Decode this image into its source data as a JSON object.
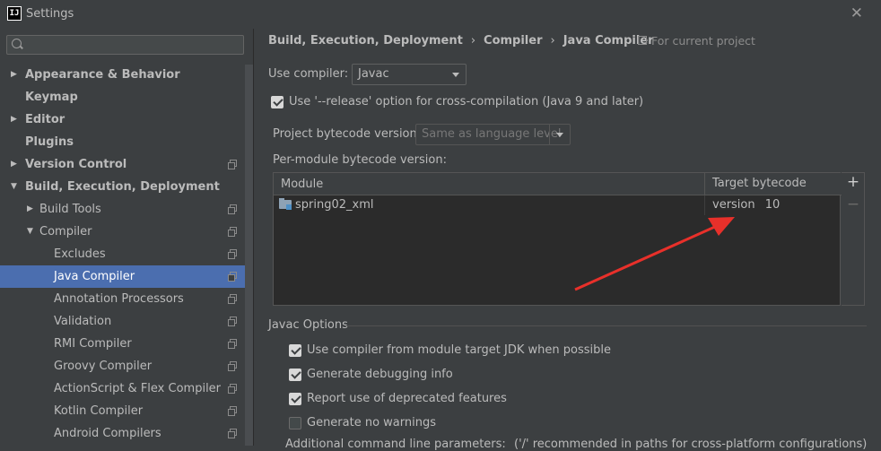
{
  "window": {
    "title": "Settings",
    "app_icon": "IJ",
    "close_glyph": "✕"
  },
  "sidebar": {
    "search_placeholder": "",
    "items": [
      {
        "label": "Appearance & Behavior",
        "arrow": "▶",
        "bold": true
      },
      {
        "label": "Keymap",
        "arrow": "",
        "bold": true
      },
      {
        "label": "Editor",
        "arrow": "▶",
        "bold": true
      },
      {
        "label": "Plugins",
        "arrow": "",
        "bold": true
      },
      {
        "label": "Version Control",
        "arrow": "▶",
        "bold": true,
        "project_icon": true
      },
      {
        "label": "Build, Execution, Deployment",
        "arrow": "▼",
        "bold": true
      },
      {
        "label": "Build Tools",
        "arrow": "▶",
        "project_icon": true
      },
      {
        "label": "Compiler",
        "arrow": "▼",
        "project_icon": true
      },
      {
        "label": "Excludes",
        "project_icon": true
      },
      {
        "label": "Java Compiler",
        "project_icon": true,
        "selected": true
      },
      {
        "label": "Annotation Processors",
        "project_icon": true
      },
      {
        "label": "Validation",
        "project_icon": true
      },
      {
        "label": "RMI Compiler",
        "project_icon": true
      },
      {
        "label": "Groovy Compiler",
        "project_icon": true
      },
      {
        "label": "ActionScript & Flex Compiler",
        "project_icon": true
      },
      {
        "label": "Kotlin Compiler",
        "project_icon": true
      },
      {
        "label": "Android Compilers",
        "project_icon": true
      }
    ]
  },
  "breadcrumb": {
    "parts": [
      "Build, Execution, Deployment",
      "Compiler",
      "Java Compiler"
    ],
    "separator": "›",
    "scope": "For current project"
  },
  "compiler": {
    "use_compiler_label": "Use compiler:",
    "use_compiler_value": "Javac",
    "release_option_label": "Use '--release' option for cross-compilation (Java 9 and later)",
    "release_option_checked": true,
    "project_bytecode_label": "Project bytecode version:",
    "project_bytecode_value": "Same as language level",
    "per_module_label": "Per-module bytecode version:"
  },
  "module_table": {
    "headers": [
      "Module",
      "Target bytecode version"
    ],
    "rows": [
      {
        "module": "spring02_xml",
        "target": "10"
      }
    ],
    "add_glyph": "+",
    "remove_glyph": "−"
  },
  "javac_options": {
    "title": "Javac Options",
    "options": [
      {
        "label": "Use compiler from module target JDK when possible",
        "checked": true
      },
      {
        "label": "Generate debugging info",
        "checked": true
      },
      {
        "label": "Report use of deprecated features",
        "checked": true
      },
      {
        "label": "Generate no warnings",
        "checked": false
      }
    ],
    "additional_params_label": "Additional command line parameters:",
    "additional_params_hint": "('/' recommended in paths for cross-platform configurations)"
  },
  "colors": {
    "accent_selection": "#4b6eaf",
    "annotation_arrow": "#e8302a",
    "background": "#3c3f41"
  }
}
